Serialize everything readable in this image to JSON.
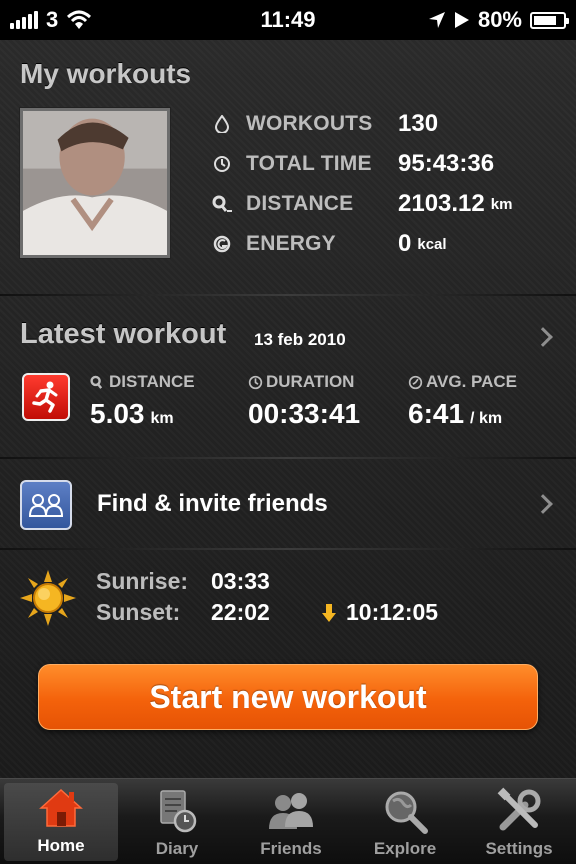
{
  "status_bar": {
    "carrier": "3",
    "time": "11:49",
    "battery": "80%",
    "battery_fraction": 0.8
  },
  "profile": {
    "title": "My workouts",
    "stats": [
      {
        "icon": "drop-icon",
        "label": "WORKOUTS",
        "value": "130",
        "unit": ""
      },
      {
        "icon": "clock-icon",
        "label": "TOTAL TIME",
        "value": "95:43:36",
        "unit": ""
      },
      {
        "icon": "distance-icon",
        "label": "DISTANCE",
        "value": "2103.12",
        "unit": "km"
      },
      {
        "icon": "energy-icon",
        "label": "ENERGY",
        "value": "0",
        "unit": "kcal"
      }
    ]
  },
  "latest": {
    "title": "Latest workout",
    "date": "13 feb 2010",
    "distance_label": "DISTANCE",
    "distance_value": "5.03",
    "distance_unit": "km",
    "duration_label": "DURATION",
    "duration_value": "00:33:41",
    "pace_label": "AVG. PACE",
    "pace_value": "6:41",
    "pace_unit": "/ km"
  },
  "friends": {
    "label": "Find & invite friends"
  },
  "sun": {
    "sunrise_label": "Sunrise:",
    "sunrise_value": "03:33",
    "sunset_label": "Sunset:",
    "sunset_value": "22:02",
    "day_length": "10:12:05"
  },
  "start_button": {
    "label": "Start new workout"
  },
  "colors": {
    "accent_orange": "#f4620b",
    "run_red": "#e01a10",
    "friends_blue": "#4a6db3"
  },
  "tabs": [
    {
      "label": "Home",
      "icon": "home-icon",
      "active": true
    },
    {
      "label": "Diary",
      "icon": "diary-icon",
      "active": false
    },
    {
      "label": "Friends",
      "icon": "friends-icon",
      "active": false
    },
    {
      "label": "Explore",
      "icon": "explore-icon",
      "active": false
    },
    {
      "label": "Settings",
      "icon": "settings-icon",
      "active": false
    }
  ]
}
